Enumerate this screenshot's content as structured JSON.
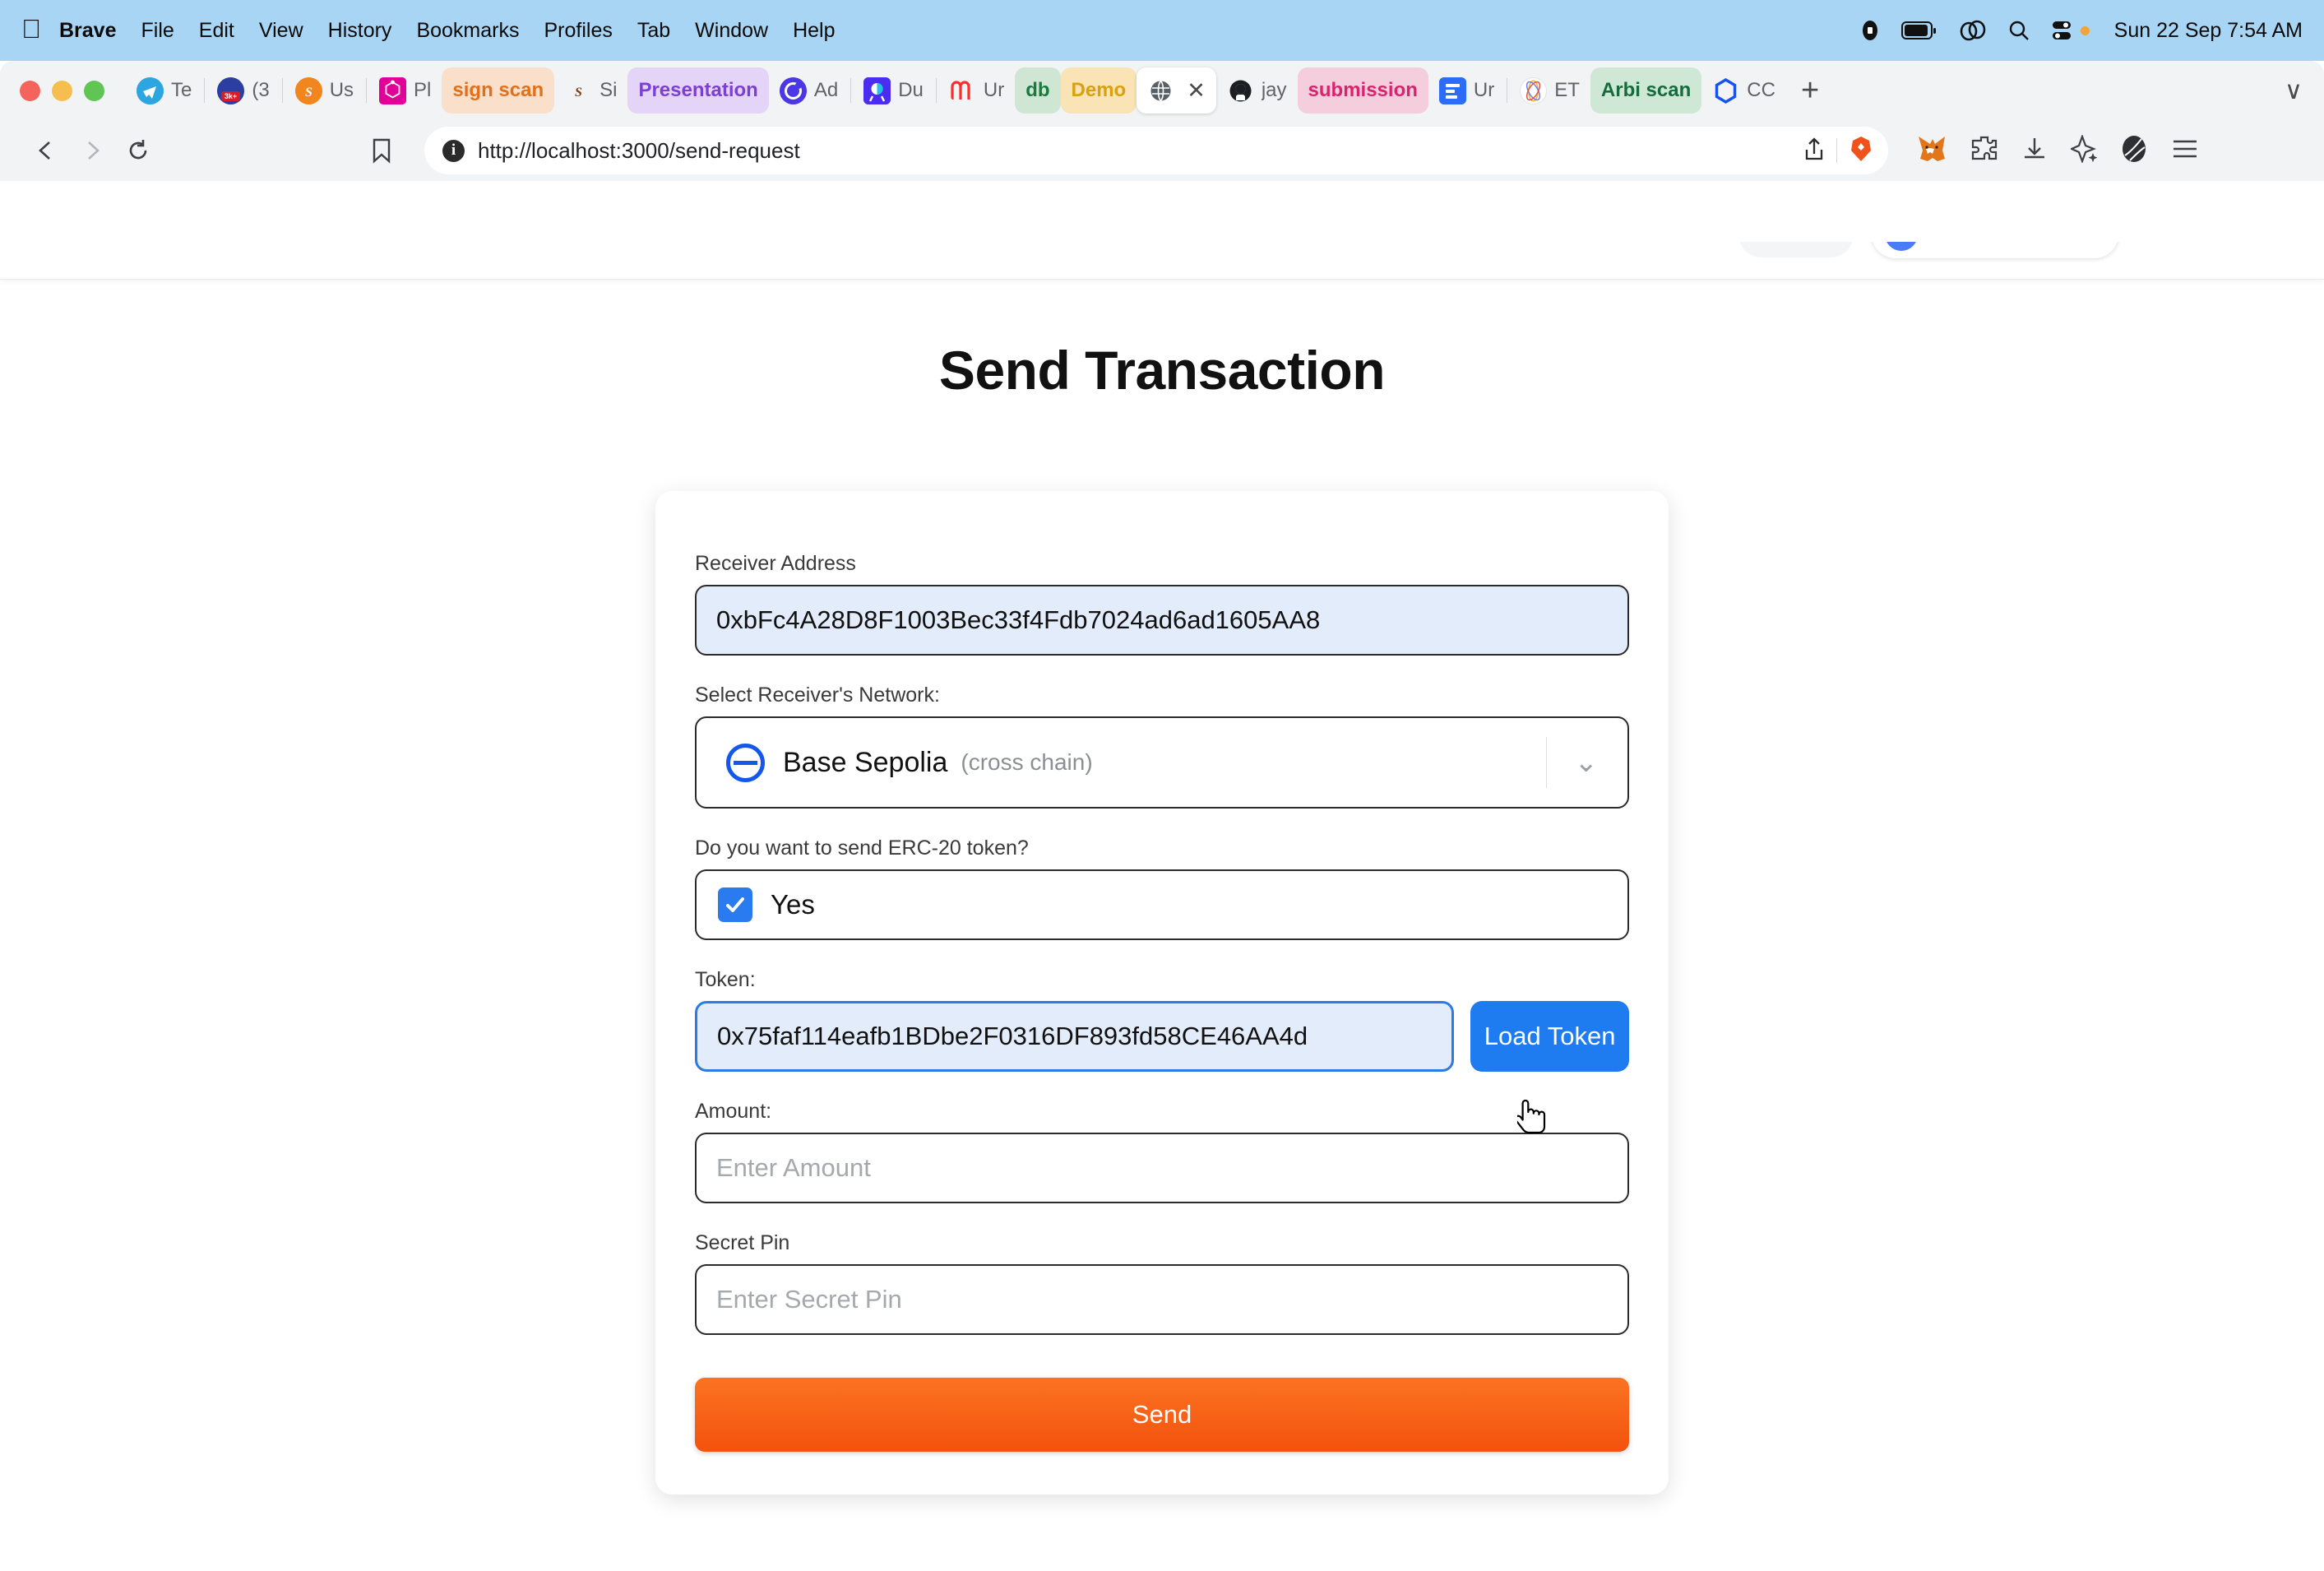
{
  "os_menubar": {
    "apple_icon": "apple-logo",
    "items": [
      "Brave",
      "File",
      "Edit",
      "View",
      "History",
      "Bookmarks",
      "Profiles",
      "Tab",
      "Window",
      "Help"
    ],
    "active_app": "Brave",
    "status_icons": [
      "recording-icon",
      "battery-icon",
      "control-link-icon",
      "search-icon",
      "control-center-icon"
    ],
    "clock": "Sun 22 Sep  7:54 AM"
  },
  "browser": {
    "tabs": [
      {
        "label": "Te",
        "favicon": "telegram-icon",
        "style": "plain"
      },
      {
        "label": "(3",
        "favicon": "badge-3k-icon",
        "style": "plain"
      },
      {
        "label": "Us",
        "favicon": "sign-icon",
        "style": "plain"
      },
      {
        "label": "Pl",
        "favicon": "graphql-icon",
        "style": "plain"
      },
      {
        "label": "sign scan",
        "favicon": "none",
        "style": "chip-orange"
      },
      {
        "label": "Si",
        "favicon": "sign-gray-icon",
        "style": "plain"
      },
      {
        "label": "Presentation",
        "favicon": "none",
        "style": "chip-purple"
      },
      {
        "label": "Ad",
        "favicon": "circle-c-icon",
        "style": "plain"
      },
      {
        "label": "Du",
        "favicon": "duo-icon",
        "style": "plain"
      },
      {
        "label": "Ur",
        "favicon": "mm-icon",
        "style": "plain"
      },
      {
        "label": "db",
        "favicon": "none",
        "style": "chip-green"
      },
      {
        "label": "Demo",
        "favicon": "none",
        "style": "chip-amber"
      },
      {
        "label": "",
        "favicon": "globe-icon",
        "style": "active"
      },
      {
        "label": "jay",
        "favicon": "github-icon",
        "style": "plain"
      },
      {
        "label": "submission",
        "favicon": "none",
        "style": "chip-pink"
      },
      {
        "label": "Ur",
        "favicon": "notion-blue-icon",
        "style": "plain"
      },
      {
        "label": "ET",
        "favicon": "eth-icon",
        "style": "plain"
      },
      {
        "label": "Arbi scan",
        "favicon": "none",
        "style": "chip-mint"
      },
      {
        "label": "CC",
        "favicon": "hex-blue-icon",
        "style": "plain"
      }
    ],
    "new_tab_label": "+",
    "tab_list_chevron": "∨",
    "nav": {
      "back": "‹",
      "forward": "›",
      "reload": "reload-icon"
    },
    "bookmark_icon": "bookmark-icon",
    "url": "http://localhost:3000/send-request",
    "url_info_icon": "info-icon",
    "share_icon": "share-icon",
    "brave_shield_icon": "brave-lion-icon",
    "extensions": [
      "metamask-fox-icon",
      "puzzle-extension-icon",
      "download-icon",
      "leo-ai-sparkle-icon",
      "profile-avatar-icon",
      "hamburger-menu-icon"
    ]
  },
  "site_header": {
    "brand": "",
    "account_label": ""
  },
  "page": {
    "title": "Send Transaction",
    "fields": {
      "receiver": {
        "label": "Receiver Address",
        "value": "0xbFc4A28D8F1003Bec33f4Fdb7024ad6ad1605AA8"
      },
      "network": {
        "label": "Select Receiver's Network:",
        "selected": "Base Sepolia",
        "badge": "(cross chain)",
        "logo": "base-network-icon",
        "chevron": "chevron-down-icon"
      },
      "erc20": {
        "label": "Do you want to send ERC-20 token?",
        "checkbox_label": "Yes",
        "checked": true
      },
      "token": {
        "label": "Token:",
        "value": "0x75faf114eafb1BDbe2F0316DF893fd58CE46AA4d",
        "button_label": "Load Token"
      },
      "amount": {
        "label": "Amount:",
        "value": "",
        "placeholder": "Enter Amount"
      },
      "secret_pin": {
        "label": "Secret Pin",
        "value": "",
        "placeholder": "Enter Secret Pin"
      }
    },
    "submit_label": "Send"
  },
  "colors": {
    "menubar_bg": "#a9d5f5",
    "chrome_bg": "#f1f3f5",
    "accent_blue": "#1f7bf0",
    "base_blue": "#1358e8",
    "send_orange_top": "#fb7322",
    "send_orange_bottom": "#f4520d",
    "input_fill": "#e3ecfa",
    "border_dark": "#2b2b2b"
  }
}
